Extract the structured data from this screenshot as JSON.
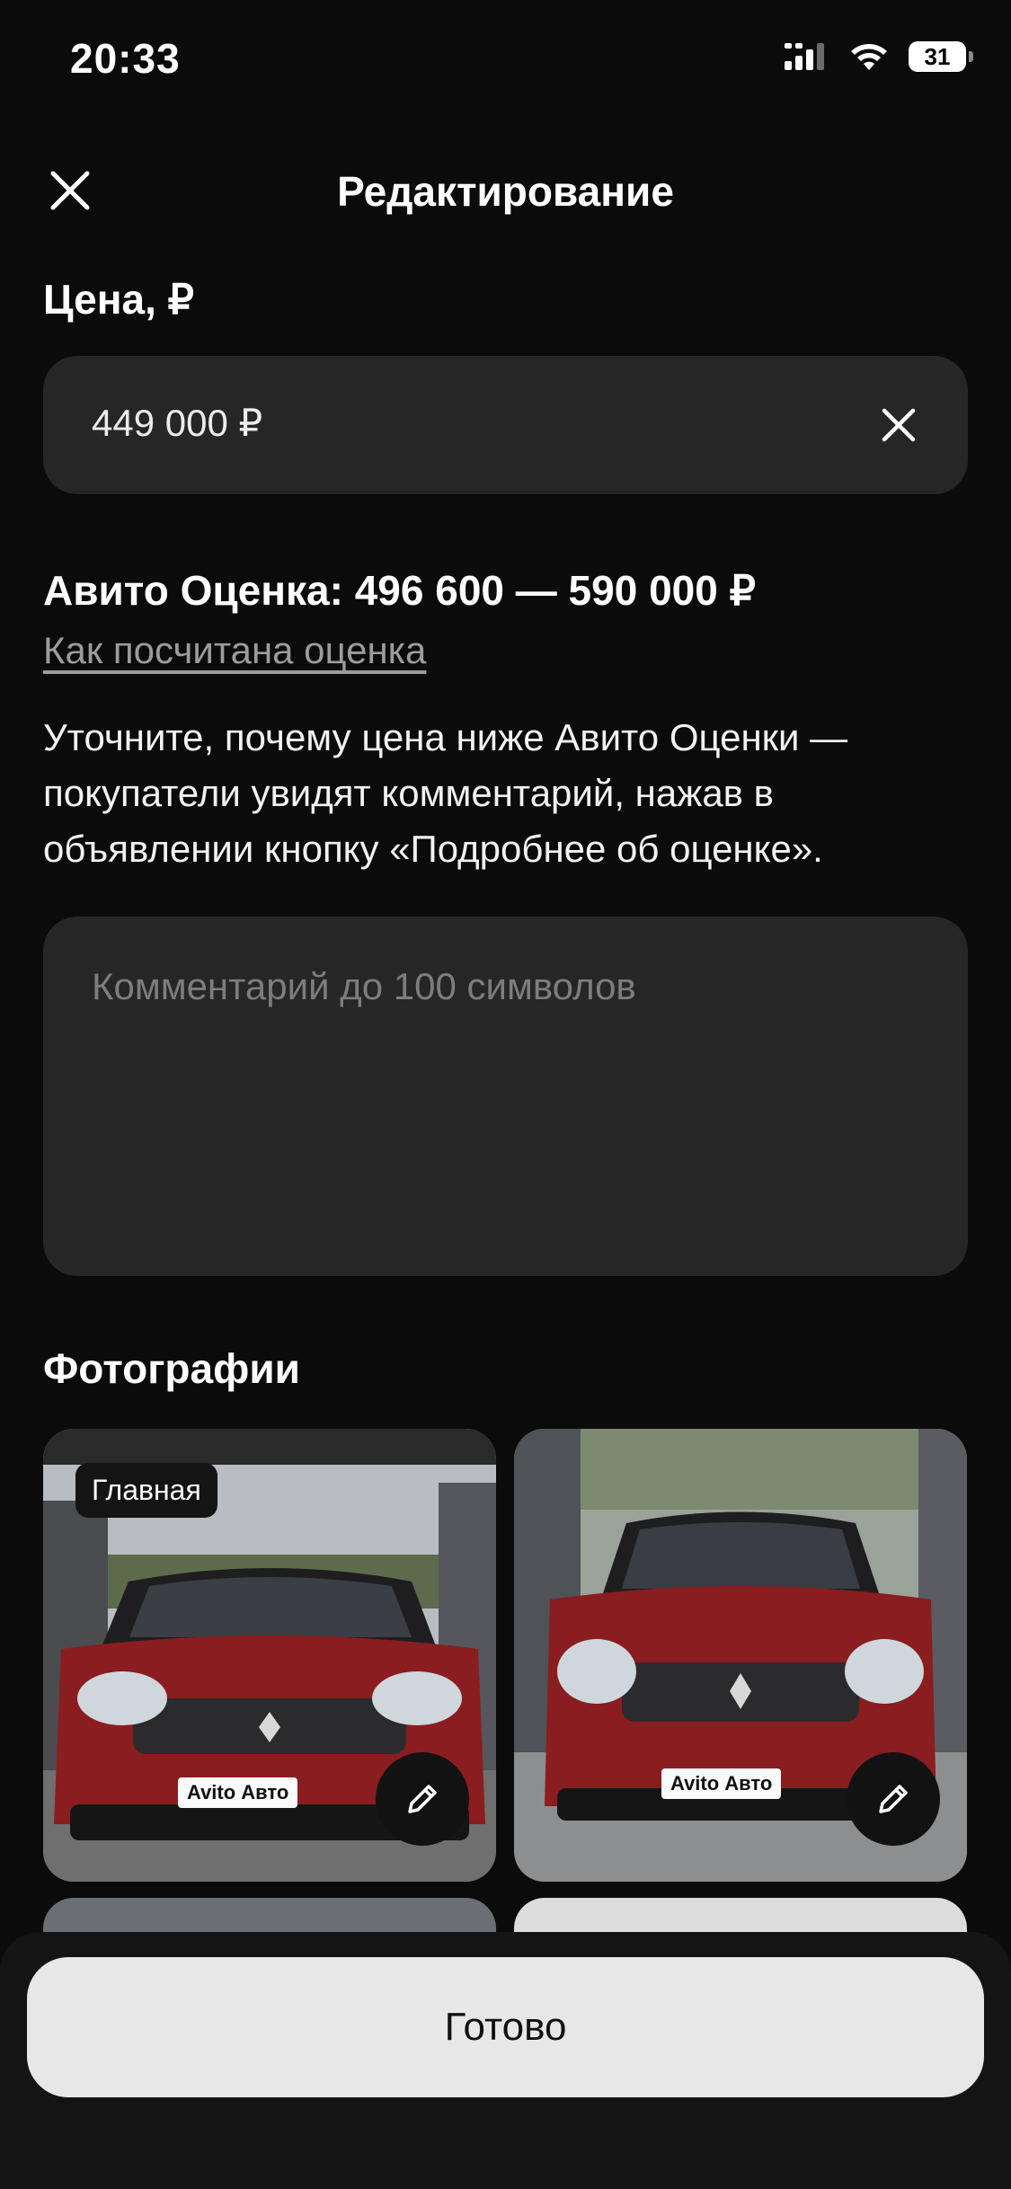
{
  "status_bar": {
    "time": "20:33",
    "battery": "31",
    "icons": [
      "signal-icon",
      "wifi-icon",
      "battery-icon"
    ]
  },
  "header": {
    "title": "Редактирование",
    "close_icon": "close-icon"
  },
  "price": {
    "label": "Цена, ₽",
    "value": "449 000 ₽",
    "clear_icon": "clear-icon"
  },
  "estimate": {
    "text": "Авито Оценка: 496 600 — 590 000 ₽",
    "link": "Как посчитана оценка",
    "explanation": "Уточните, почему цена ниже Авито Оценки — покупатели увидят комментарий, нажав в объявлении кнопку «Подробнее об оценке»."
  },
  "comment": {
    "placeholder": "Комментарий до 100 символов",
    "value": ""
  },
  "photos": {
    "title": "Фотографии",
    "main_badge": "Главная",
    "plate_text": "Avito Авто",
    "edit_icon": "pencil-icon"
  },
  "footer": {
    "done_label": "Готово"
  },
  "colors": {
    "background": "#0b0b0b",
    "field": "#262626",
    "button": "#e7e7e7",
    "car_red": "#8a1d1f"
  }
}
